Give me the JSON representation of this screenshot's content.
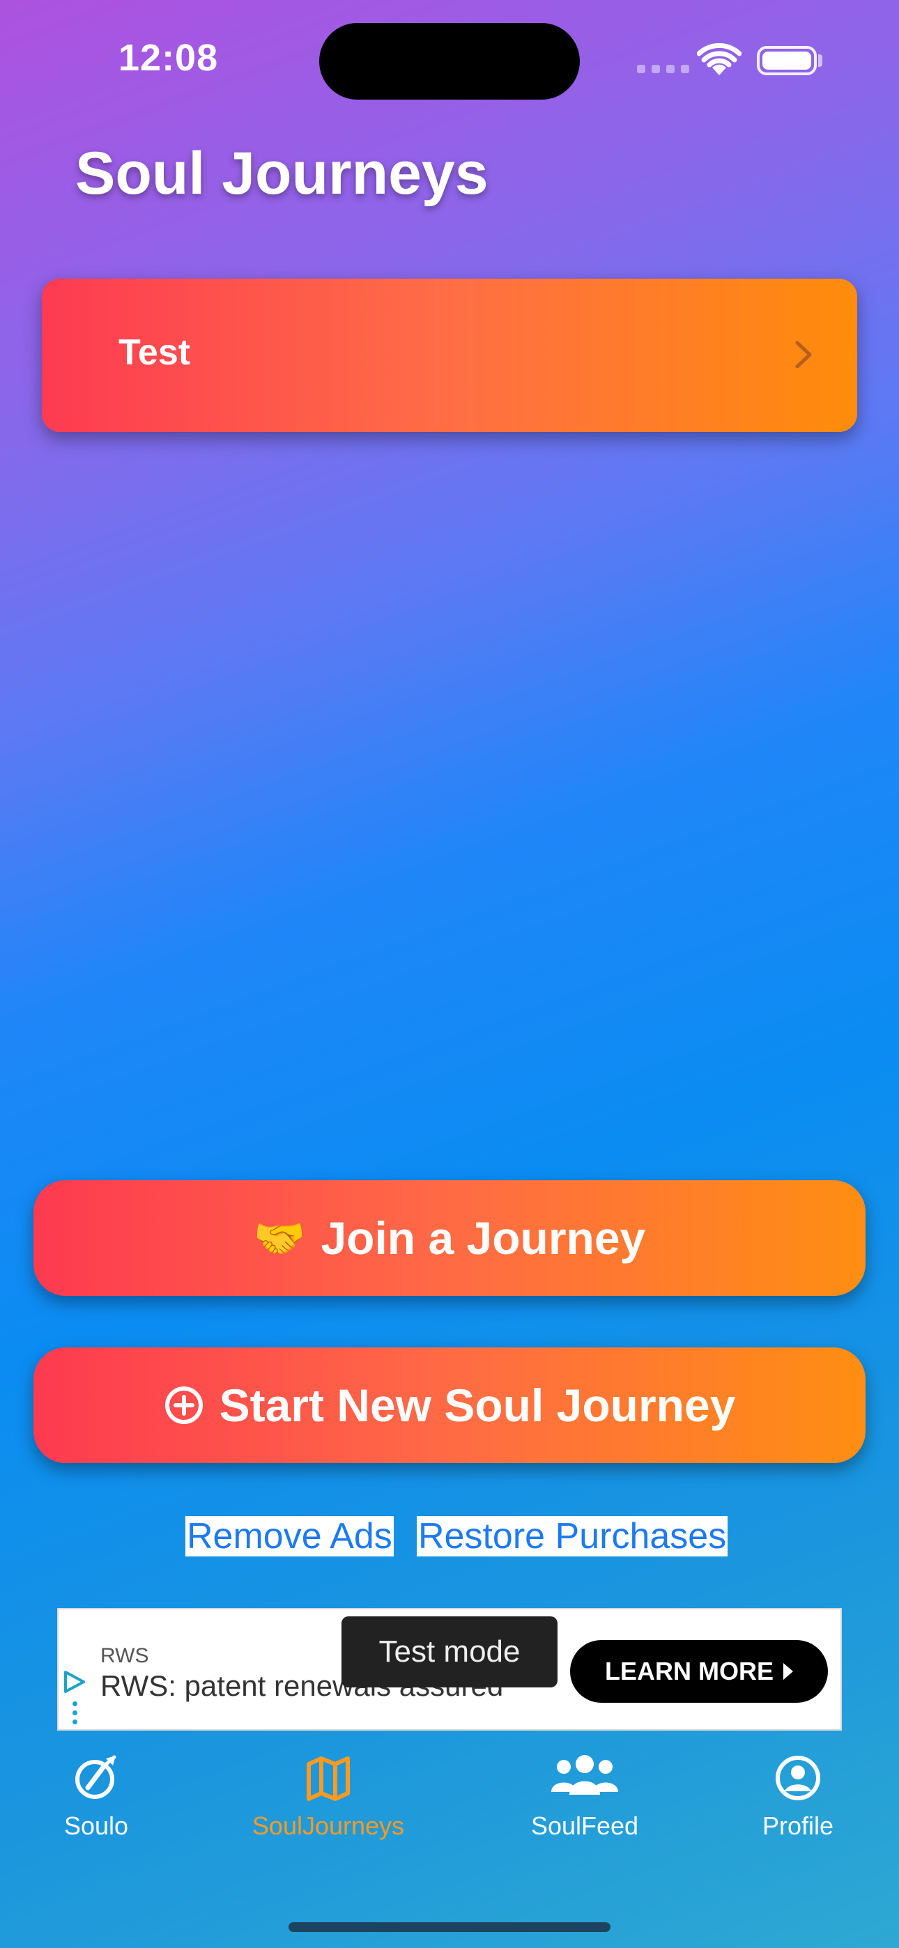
{
  "status_bar": {
    "time": "12:08"
  },
  "page": {
    "title": "Soul Journeys"
  },
  "journeys": [
    {
      "label": "Test"
    }
  ],
  "actions": {
    "join_emoji": "🤝",
    "join_label": "Join a Journey",
    "start_label": "Start New Soul Journey"
  },
  "links": {
    "remove_ads": "Remove Ads",
    "restore_purchases": "Restore Purchases"
  },
  "ad": {
    "advertiser": "RWS",
    "headline": "RWS: patent renewals assured",
    "cta": "LEARN MORE",
    "test_mode_label": "Test mode"
  },
  "tab_bar": {
    "active": "SoulJourneys",
    "active_color": "#ff9a1f",
    "items": [
      {
        "label": "Soulo",
        "icon": "compass-edit-icon"
      },
      {
        "label": "SoulJourneys",
        "icon": "map-icon"
      },
      {
        "label": "SoulFeed",
        "icon": "people-icon"
      },
      {
        "label": "Profile",
        "icon": "profile-icon"
      }
    ]
  },
  "colors": {
    "button_gradient_start": "#fd3a50",
    "button_gradient_end": "#ff8e12",
    "link_color": "#1d7af0"
  }
}
